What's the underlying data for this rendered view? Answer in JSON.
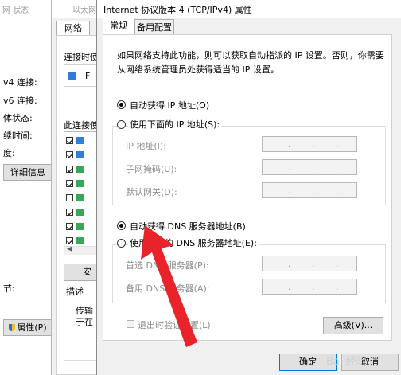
{
  "status_window": {
    "title": "网 状态",
    "labels": [
      "v4 连接:",
      "v6 连接:",
      "体状态:",
      "续时间:",
      "度:"
    ],
    "details_button": "详细信息",
    "section_label": "节:",
    "properties_button": "属性(P)"
  },
  "ethernet_window": {
    "title": "以太网",
    "tab_network": "网络",
    "connect_using": "连接时使",
    "adapter_initial": "F",
    "items_label": "此连接使",
    "install_button": "安",
    "description_title": "描述",
    "description_lines": [
      "传输",
      "于在"
    ],
    "items_checked": [
      true,
      true,
      true,
      true,
      false,
      true,
      true,
      true
    ]
  },
  "dialog": {
    "title": "Internet 协议版本 4 (TCP/IPv4) 属性",
    "tabs": [
      {
        "label": "常规",
        "active": true
      },
      {
        "label": "备用配置",
        "active": false
      }
    ],
    "description": "如果网络支持此功能，则可以获取自动指派的 IP 设置。否则，你需要从网络系统管理员处获得适当的 IP 设置。",
    "ip_section": {
      "auto_label": "自动获得 IP 地址(O)",
      "auto_selected": true,
      "manual_label": "使用下面的 IP 地址(S):",
      "fields": [
        {
          "label": "IP 地址(I):",
          "value": ".   .   ."
        },
        {
          "label": "子网掩码(U):",
          "value": ".   .   ."
        },
        {
          "label": "默认网关(D):",
          "value": ".   .   ."
        }
      ]
    },
    "dns_section": {
      "auto_label": "自动获得 DNS 服务器地址(B)",
      "auto_selected": true,
      "manual_label": "使用下面的 DNS 服务器地址(E):",
      "fields": [
        {
          "label": "首选 DNS 服务器(P):",
          "value": ".   .   ."
        },
        {
          "label": "备用 DNS 服务器(A):",
          "value": ".   .   ."
        }
      ]
    },
    "validate_label": "退出时验证设置(L)",
    "advanced_button": "高级(V)...",
    "ok_button": "确定",
    "cancel_button": "取消"
  },
  "annotation": {
    "arrow_color": "#e8232a"
  },
  "watermark": "Bai 经验"
}
